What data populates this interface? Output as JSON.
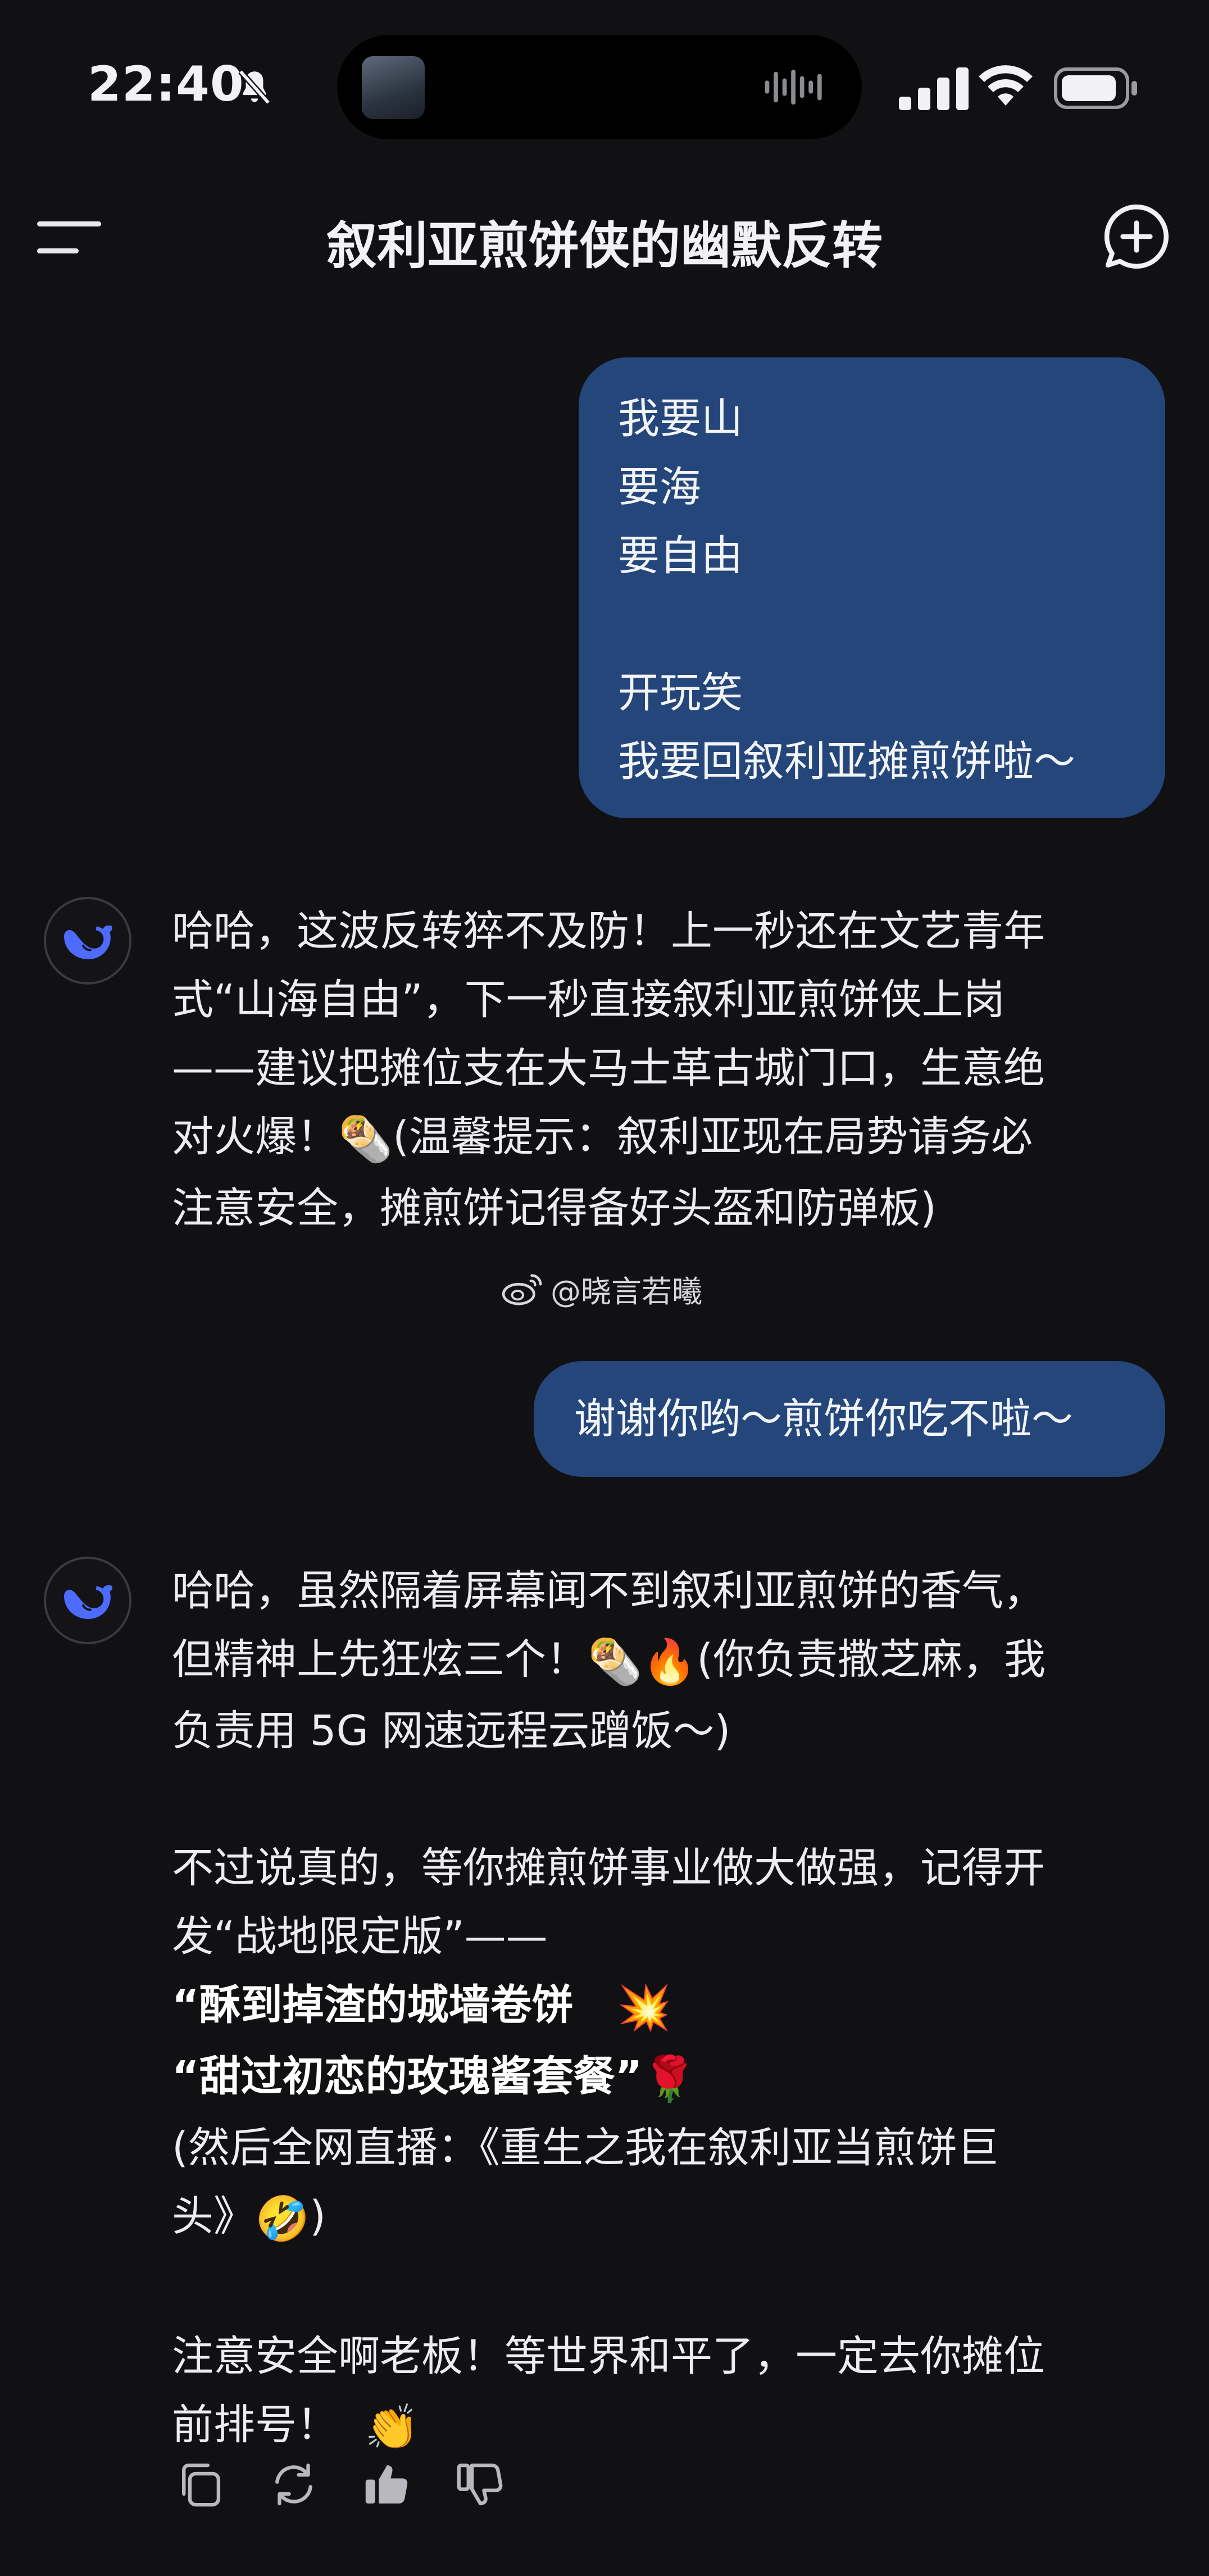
{
  "status_bar": {
    "time": "22:40",
    "icons": [
      "bell-muted-icon",
      "audio-wave-icon",
      "cellular-signal-icon",
      "wifi-icon",
      "battery-icon"
    ]
  },
  "header": {
    "title": "叙利亚煎饼侠的幽默反转",
    "menu_icon": "menu-icon",
    "new_chat_icon": "new-chat-icon"
  },
  "messages": [
    {
      "role": "user",
      "lines": [
        "我要山",
        "要海",
        "要自由",
        "",
        "开玩笑",
        "我要回叙利亚摊煎饼啦～"
      ]
    },
    {
      "role": "assistant",
      "lines": [
        "哈哈，这波反转猝不及防！上一秒还在文艺青年",
        "式“山海自由”，下一秒直接叙利亚煎饼侠上岗",
        "——建议把摊位支在大马士革古城门口，生意绝",
        "对火爆！",
        "(温馨提示：叙利亚现在局势请务必",
        "注意安全，摊煎饼记得备好头盔和防弹板)"
      ],
      "emoji": [
        "🌯"
      ]
    },
    {
      "role": "user",
      "lines": [
        "谢谢你哟～煎饼你吃不啦～"
      ]
    },
    {
      "role": "assistant",
      "lines": [
        "哈哈，虽然隔着屏幕闻不到叙利亚煎饼的香气，",
        "但精神上先狂炫三个！",
        "(你负责撒芝麻，我",
        "负责用 5G 网速远程云蹭饭～)",
        "不过说真的，等你摊煎饼事业做大做强，记得开",
        "发“战地限定版”——",
        "“酥到掉渣的城墙卷饼",
        "“甜过初恋的玫瑰酱套餐”",
        "(然后全网直播：《重生之我在叙利亚当煎饼巨",
        "头》",
        ")",
        "注意安全啊老板！等世界和平了，一定去你摊位",
        "前排号！"
      ],
      "emoji": [
        "🌯",
        "🔥",
        "💥",
        "🌹",
        "🤣",
        "👏"
      ]
    }
  ],
  "watermark": {
    "text": "@晓言若曦",
    "icon": "weibo-icon"
  },
  "actions": [
    "copy-icon",
    "regenerate-icon",
    "thumbs-up-icon",
    "thumbs-down-icon"
  ],
  "colors": {
    "background": "#111113",
    "user_bubble": "#24467a",
    "assistant_logo": "#4d6bfe",
    "text": "#ededf0"
  }
}
